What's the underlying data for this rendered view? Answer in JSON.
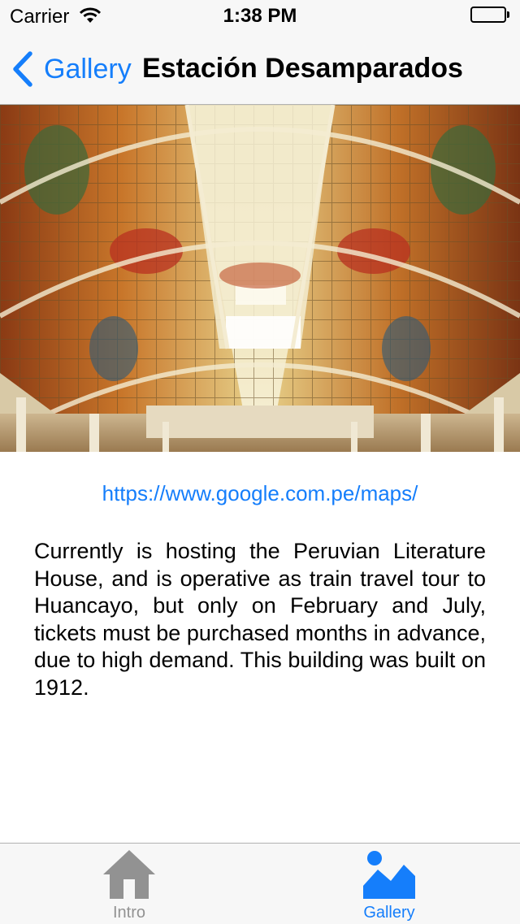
{
  "status_bar": {
    "carrier": "Carrier",
    "time": "1:38 PM",
    "battery_level": 1.0
  },
  "nav_bar": {
    "back_label": "Gallery",
    "title": "Estación Desamparados"
  },
  "content": {
    "map_link": "https://www.google.com.pe/maps/",
    "description": "Currently is hosting the Peruvian Literature House, and is operative as train travel tour to Huancayo, but only on February and July, tickets must be purchased months in advance, due to high demand. This building was built on 1912."
  },
  "tab_bar": {
    "tabs": [
      {
        "label": "Intro",
        "icon": "home-icon",
        "selected": false
      },
      {
        "label": "Gallery",
        "icon": "gallery-icon",
        "selected": true
      }
    ]
  },
  "colors": {
    "accent": "#157efb",
    "inactive": "#929292",
    "bar_background": "#f7f7f7"
  }
}
